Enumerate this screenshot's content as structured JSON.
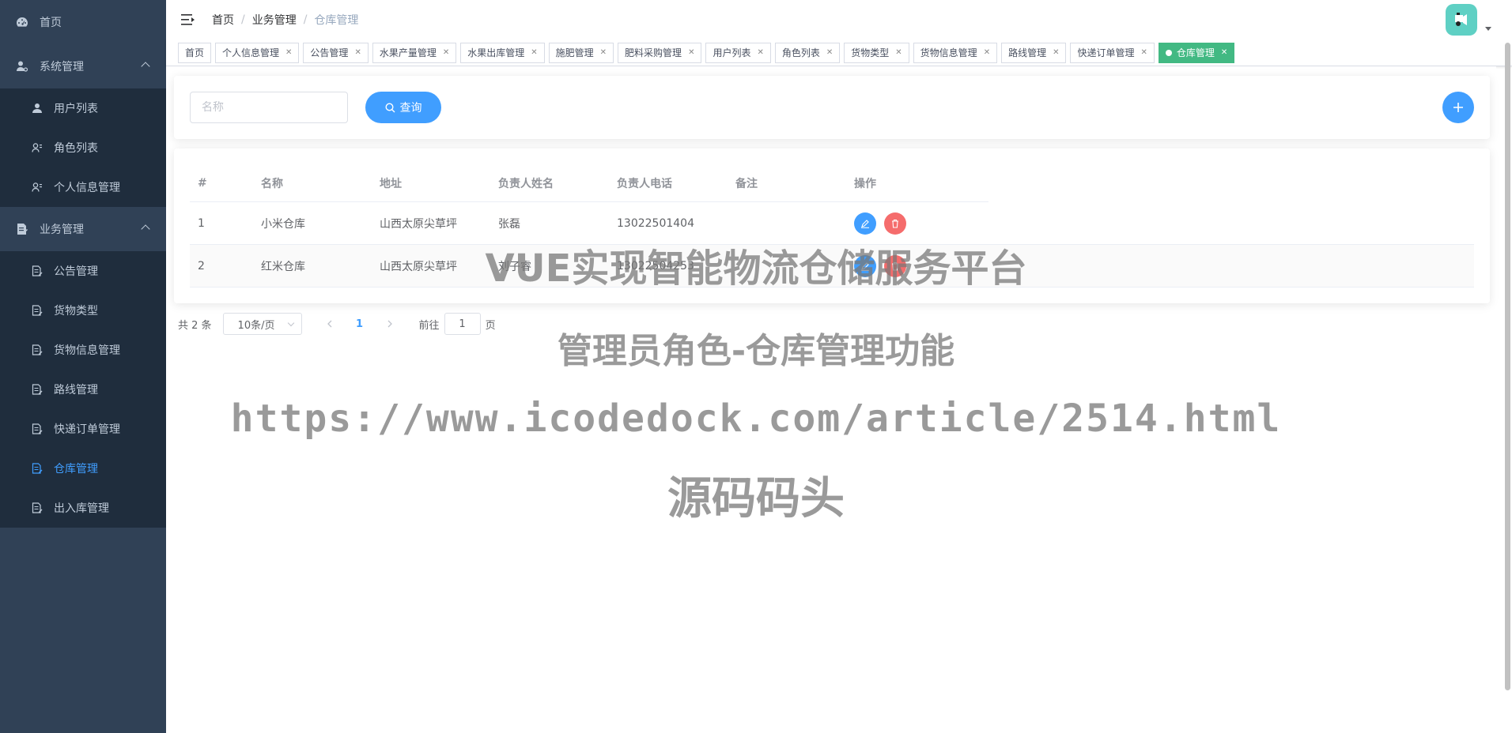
{
  "colors": {
    "sidebar_bg": "#304156",
    "submenu_bg": "#1f2d3d",
    "primary": "#409eff",
    "danger": "#f56c6c",
    "tag_active": "#42b983",
    "avatar_bg": "#5fd0c4"
  },
  "sidebar": {
    "home": {
      "label": "首页",
      "icon": "dashboard-icon"
    },
    "groups": [
      {
        "title": "系统管理",
        "icon": "user-settings-icon",
        "items": [
          {
            "label": "用户列表",
            "icon": "user-icon"
          },
          {
            "label": "角色列表",
            "icon": "role-icon"
          },
          {
            "label": "个人信息管理",
            "icon": "role-icon"
          }
        ]
      },
      {
        "title": "业务管理",
        "icon": "document-icon",
        "items": [
          {
            "label": "公告管理",
            "icon": "document-icon"
          },
          {
            "label": "货物类型",
            "icon": "document-icon"
          },
          {
            "label": "货物信息管理",
            "icon": "document-icon"
          },
          {
            "label": "路线管理",
            "icon": "document-icon"
          },
          {
            "label": "快递订单管理",
            "icon": "document-icon"
          },
          {
            "label": "仓库管理",
            "icon": "document-icon",
            "active": true
          },
          {
            "label": "出入库管理",
            "icon": "document-icon"
          }
        ]
      }
    ]
  },
  "breadcrumb": [
    "首页",
    "业务管理",
    "仓库管理"
  ],
  "tags": [
    "首页",
    "个人信息管理",
    "公告管理",
    "水果产量管理",
    "水果出库管理",
    "施肥管理",
    "肥料采购管理",
    "用户列表",
    "角色列表",
    "货物类型",
    "货物信息管理",
    "路线管理",
    "快递订单管理",
    "仓库管理"
  ],
  "search": {
    "placeholder": "名称",
    "button_label": "查询"
  },
  "table": {
    "columns": [
      "#",
      "名称",
      "地址",
      "负责人姓名",
      "负责人电话",
      "备注",
      "操作"
    ],
    "rows": [
      {
        "index": "1",
        "name": "小米仓库",
        "address": "山西太原尖草坪",
        "manager": "张磊",
        "phone": "13022501404",
        "remark": ""
      },
      {
        "index": "2",
        "name": "红米仓库",
        "address": "山西太原尖草坪",
        "manager": "刘子睿",
        "phone": "13022504253",
        "remark": ""
      }
    ]
  },
  "pagination": {
    "total_text": "共 2 条",
    "page_size": "10条/页",
    "current_page": "1",
    "goto_prefix": "前往",
    "goto_value": "1",
    "goto_suffix": "页"
  },
  "watermark": {
    "line1": "VUE实现智能物流仓储服务平台",
    "line2": "管理员角色-仓库管理功能",
    "line3": "https://www.icodedock.com/article/2514.html",
    "line4": "源码码头"
  }
}
